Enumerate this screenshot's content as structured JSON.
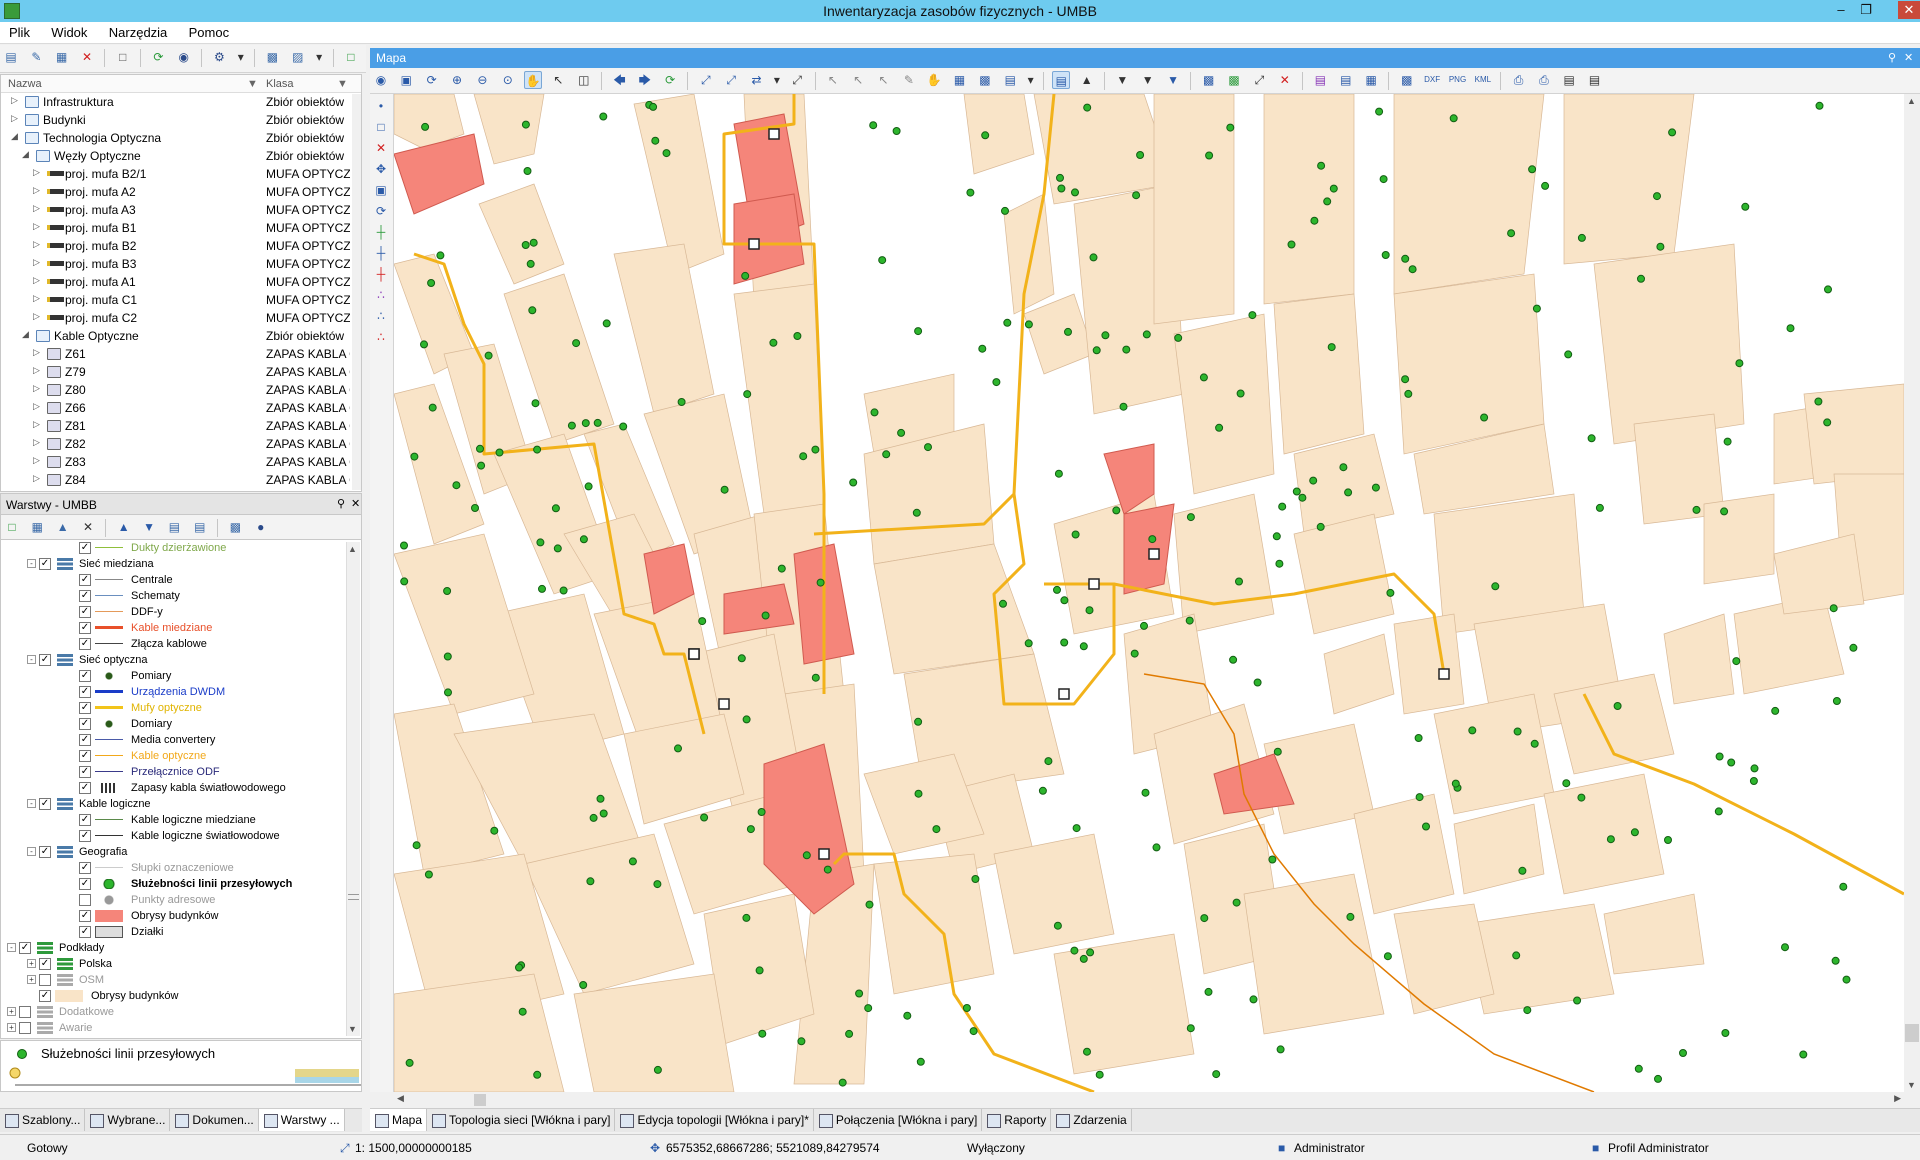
{
  "window": {
    "title": "Inwentaryzacja zasobów fizycznych - UMBB"
  },
  "menu": [
    "Plik",
    "Widok",
    "Narzędzia",
    "Pomoc"
  ],
  "tree": {
    "columns": [
      "Nazwa",
      "Klasa"
    ],
    "rows": [
      {
        "name": "Infrastruktura",
        "cls": "Zbiór obiektów",
        "level": 0,
        "icon": "folder"
      },
      {
        "name": "Budynki",
        "cls": "Zbiór obiektów",
        "level": 0,
        "icon": "folder"
      },
      {
        "name": "Technologia Optyczna",
        "cls": "Zbiór obiektów",
        "level": 0,
        "icon": "folder"
      },
      {
        "name": "Węzły Optyczne",
        "cls": "Zbiór obiektów",
        "level": 1,
        "icon": "folder"
      },
      {
        "name": "proj. mufa B2/1",
        "cls": "MUFA OPTYCZN",
        "level": 2,
        "icon": "mufa"
      },
      {
        "name": "proj. mufa A2",
        "cls": "MUFA OPTYCZN",
        "level": 2,
        "icon": "mufa"
      },
      {
        "name": "proj. mufa A3",
        "cls": "MUFA OPTYCZN",
        "level": 2,
        "icon": "mufa"
      },
      {
        "name": "proj. mufa B1",
        "cls": "MUFA OPTYCZN",
        "level": 2,
        "icon": "mufa"
      },
      {
        "name": "proj. mufa B2",
        "cls": "MUFA OPTYCZN",
        "level": 2,
        "icon": "mufa"
      },
      {
        "name": "proj. mufa B3",
        "cls": "MUFA OPTYCZN",
        "level": 2,
        "icon": "mufa"
      },
      {
        "name": "proj. mufa A1",
        "cls": "MUFA OPTYCZN",
        "level": 2,
        "icon": "mufa"
      },
      {
        "name": "proj. mufa C1",
        "cls": "MUFA OPTYCZN",
        "level": 2,
        "icon": "mufa"
      },
      {
        "name": "proj. mufa C2",
        "cls": "MUFA OPTYCZN",
        "level": 2,
        "icon": "mufa"
      },
      {
        "name": "Kable Optyczne",
        "cls": "Zbiór obiektów",
        "level": 1,
        "icon": "folder"
      },
      {
        "name": "Z61",
        "cls": "ZAPAS KABLA C",
        "level": 2,
        "icon": "kabel"
      },
      {
        "name": "Z79",
        "cls": "ZAPAS KABLA C",
        "level": 2,
        "icon": "kabel"
      },
      {
        "name": "Z80",
        "cls": "ZAPAS KABLA C",
        "level": 2,
        "icon": "kabel"
      },
      {
        "name": "Z66",
        "cls": "ZAPAS KABLA C",
        "level": 2,
        "icon": "kabel"
      },
      {
        "name": "Z81",
        "cls": "ZAPAS KABLA C",
        "level": 2,
        "icon": "kabel"
      },
      {
        "name": "Z82",
        "cls": "ZAPAS KABLA C",
        "level": 2,
        "icon": "kabel"
      },
      {
        "name": "Z83",
        "cls": "ZAPAS KABLA C",
        "level": 2,
        "icon": "kabel"
      },
      {
        "name": "Z84",
        "cls": "ZAPAS KABLA C",
        "level": 2,
        "icon": "kabel"
      }
    ]
  },
  "layers_panel": {
    "title": "Warstwy - UMBB",
    "rows": [
      {
        "name": "Dukty dzierżawione",
        "level": 3,
        "checked": true,
        "symbol": "line",
        "color": "#8fbf3a",
        "style": "faded-green"
      },
      {
        "name": "Sieć miedziana",
        "level": 1,
        "checked": true,
        "group": "blue",
        "twisty": "-"
      },
      {
        "name": "Centrale",
        "level": 3,
        "checked": true,
        "symbol": "line",
        "color": "#888888"
      },
      {
        "name": "Schematy",
        "level": 3,
        "checked": true,
        "symbol": "line",
        "color": "#6a8fbf"
      },
      {
        "name": "DDF-y",
        "level": 3,
        "checked": true,
        "symbol": "line",
        "color": "#e49a5a"
      },
      {
        "name": "Kable miedziane",
        "level": 3,
        "checked": true,
        "symbol": "thickline",
        "color": "#e8502a",
        "style": "red"
      },
      {
        "name": "Złącza kablowe",
        "level": 3,
        "checked": true,
        "symbol": "line",
        "color": "#444444"
      },
      {
        "name": "Sieć optyczna",
        "level": 1,
        "checked": true,
        "group": "blue",
        "twisty": "-"
      },
      {
        "name": "Pomiary",
        "level": 3,
        "checked": true,
        "symbol": "dot",
        "color": "#2a5a1a"
      },
      {
        "name": "Urządzenia DWDM",
        "level": 3,
        "checked": true,
        "symbol": "thickline",
        "color": "#1a3cc8",
        "style": "blue"
      },
      {
        "name": "Mufy optyczne",
        "level": 3,
        "checked": true,
        "symbol": "thickline",
        "color": "#f2c41a",
        "style": "yellow"
      },
      {
        "name": "Domiary",
        "level": 3,
        "checked": true,
        "symbol": "dot",
        "color": "#2a5a1a"
      },
      {
        "name": "Media convertery",
        "level": 3,
        "checked": true,
        "symbol": "line",
        "color": "#4a5aa8"
      },
      {
        "name": "Kable optyczne",
        "level": 3,
        "checked": true,
        "symbol": "line",
        "color": "#f2a81a",
        "style": "orange"
      },
      {
        "name": "Przełącznice ODF",
        "level": 3,
        "checked": true,
        "symbol": "line",
        "color": "#3a3a8a",
        "style": "navy"
      },
      {
        "name": "Zapasy kabla światłowodowego",
        "level": 3,
        "checked": true,
        "symbol": "coil",
        "color": "#333333"
      },
      {
        "name": "Kable logiczne",
        "level": 1,
        "checked": true,
        "group": "blue",
        "twisty": "-"
      },
      {
        "name": "Kable logiczne miedziane",
        "level": 3,
        "checked": true,
        "symbol": "line",
        "color": "#5a8a4a"
      },
      {
        "name": "Kable logiczne światłowodowe",
        "level": 3,
        "checked": true,
        "symbol": "line",
        "color": "#333333"
      },
      {
        "name": "Geografia",
        "level": 1,
        "checked": true,
        "group": "blue",
        "twisty": "-"
      },
      {
        "name": "Słupki oznaczeniowe",
        "level": 3,
        "checked": true,
        "symbol": "line",
        "color": "#cccccc",
        "style": "faded"
      },
      {
        "name": "Służebności linii przesyłowych",
        "level": 3,
        "checked": true,
        "symbol": "greendot",
        "color": "#2db52d",
        "style": "bold"
      },
      {
        "name": "Punkty adresowe",
        "level": 3,
        "checked": false,
        "symbol": "pin",
        "color": "#999999",
        "style": "faded"
      },
      {
        "name": "Obrysy budynków",
        "level": 3,
        "checked": true,
        "symbol": "fillbox",
        "color": "#f5857a"
      },
      {
        "name": "Działki",
        "level": 3,
        "checked": true,
        "symbol": "graybox",
        "color": "#dddddd"
      },
      {
        "name": "Podkłady",
        "level": 0,
        "checked": true,
        "group": "green",
        "twisty": "-"
      },
      {
        "name": "Polska",
        "level": 1,
        "checked": true,
        "group": "green",
        "twisty": "+"
      },
      {
        "name": "OSM",
        "level": 1,
        "checked": false,
        "group": "gray",
        "twisty": "+",
        "style": "faded"
      },
      {
        "name": "Obrysy budynków",
        "level": 1,
        "checked": true,
        "symbol": "beigebox",
        "color": "#f9e4c8"
      },
      {
        "name": "Dodatkowe",
        "level": 0,
        "checked": false,
        "group": "gray",
        "twisty": "+",
        "style": "faded"
      },
      {
        "name": "Awarie",
        "level": 0,
        "checked": false,
        "group": "gray",
        "twisty": "+",
        "style": "faded"
      }
    ]
  },
  "legend": {
    "label": "Służebności linii przesyłowych"
  },
  "left_tabs": [
    "Szablony...",
    "Wybrane...",
    "Dokumen...",
    "Warstwy ..."
  ],
  "map": {
    "title": "Mapa",
    "colors": {
      "building": "#f9e4c8",
      "building_highlight": "#f5857a",
      "cable": "#f2b21a",
      "cable_dark": "#e07a00",
      "pole": "#2db52d"
    }
  },
  "map_tabs": [
    "Mapa",
    "Topologia sieci [Włókna i pary]",
    "Edycja topologii [Włókna i pary]*",
    "Połączenia [Włókna i pary]",
    "Raporty",
    "Zdarzenia"
  ],
  "status": {
    "state": "Gotowy",
    "scale": "1: 1500,00000000185",
    "coords": "6575352,68667286; 5521089,84279574",
    "mode": "Wyłączony",
    "user": "Administrator",
    "profile": "Profil Administrator"
  }
}
